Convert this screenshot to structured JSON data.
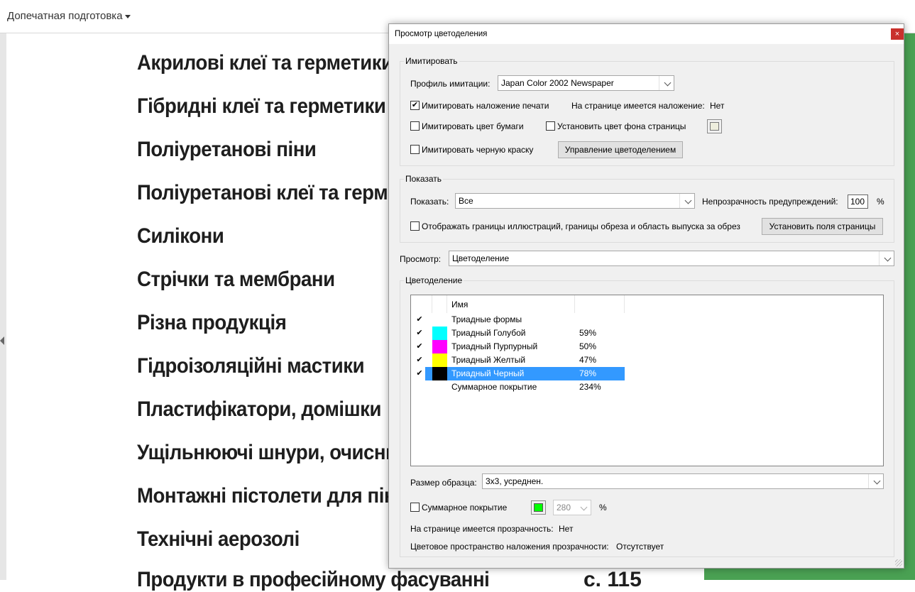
{
  "app": {
    "tool_label": "Допечатная подготовка",
    "document_lines": [
      "Акрилові клеї та герметики",
      "Гібридні клеї та герметики",
      "Поліуретанові піни",
      "Поліуретанові клеї та герметики",
      "Силікони",
      "Стрічки та мембрани",
      "Різна продукція",
      "Гідроізоляційні мастики",
      "Пластифікатори, домішки",
      "Ущільнюючі шнури, очисники",
      "Монтажні пістолети для піни",
      "Технічні аерозолі",
      "Продукти в професійному фасуванні"
    ],
    "page_number": "с. 115"
  },
  "dialog": {
    "title": "Просмотр цветоделения",
    "close_glyph": "×",
    "simulate": {
      "group_label": "Имитировать",
      "profile_label": "Профиль имитации:",
      "profile_value": "Japan Color 2002 Newspaper",
      "overprint_label": "Имитировать наложение печати",
      "overprint_checked": "✔",
      "page_has_overprint_label": "На странице имеется наложение:",
      "page_has_overprint_value": "Нет",
      "paper_color_label": "Имитировать цвет бумаги",
      "page_bg_label": "Установить цвет фона страницы",
      "page_bg_color": "#eeeedd",
      "black_ink_label": "Имитировать черную краску",
      "ink_manager_button": "Управление цветоделением"
    },
    "show": {
      "group_label": "Показать",
      "show_label": "Показать:",
      "show_value": "Все",
      "warning_opacity_label": "Непрозрачность предупреждений:",
      "warning_opacity_value": "100",
      "percent": "%",
      "boxes_label": "Отображать границы иллюстраций, границы обреза и область выпуска за обрез",
      "page_boxes_button": "Установить поля страницы"
    },
    "preview": {
      "label": "Просмотр:",
      "value": "Цветоделение"
    },
    "separations": {
      "group_label": "Цветоделение",
      "column_name": "Имя",
      "rows": [
        {
          "checked": "✔",
          "swatch": "",
          "name": "Триадные формы",
          "percent": ""
        },
        {
          "checked": "✔",
          "swatch": "#00ffff",
          "name": "Триадный Голубой",
          "percent": "59%"
        },
        {
          "checked": "✔",
          "swatch": "#ff00ff",
          "name": "Триадный Пурпурный",
          "percent": "50%"
        },
        {
          "checked": "✔",
          "swatch": "#ffff00",
          "name": "Триадный Желтый",
          "percent": "47%"
        },
        {
          "checked": "✔",
          "swatch": "#000000",
          "name": "Триадный Черный",
          "percent": "78%"
        },
        {
          "checked": "",
          "swatch": "",
          "name": "Суммарное покрытие",
          "percent": "234%"
        }
      ],
      "sample_size_label": "Размер образца:",
      "sample_size_value": "3x3, усреднен.",
      "total_coverage_label": "Суммарное покрытие",
      "total_coverage_color": "#00ff00",
      "total_coverage_value": "280",
      "percent": "%",
      "transparency_label": "На странице имеется прозрачность:",
      "transparency_value": "Нет",
      "blend_space_label": "Цветовое пространство наложения прозрачности:",
      "blend_space_value": "Отсутствует"
    }
  }
}
